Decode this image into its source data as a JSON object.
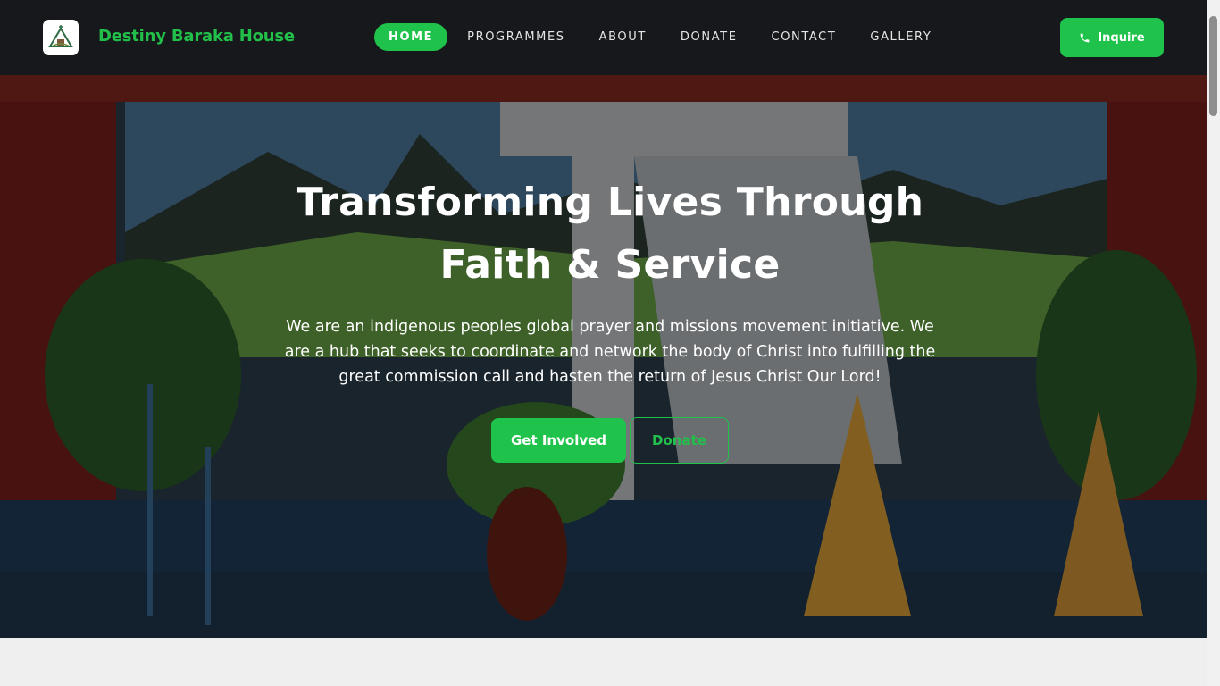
{
  "brand": {
    "name": "Destiny Baraka House",
    "logo_icon": "church-logo-icon"
  },
  "nav": {
    "items": [
      {
        "label": "HOME",
        "active": true
      },
      {
        "label": "PROGRAMMES",
        "active": false
      },
      {
        "label": "ABOUT",
        "active": false
      },
      {
        "label": "DONATE",
        "active": false
      },
      {
        "label": "CONTACT",
        "active": false
      },
      {
        "label": "GALLERY",
        "active": false
      }
    ],
    "inquire_label": "Inquire",
    "inquire_icon": "phone-icon"
  },
  "hero": {
    "title_line1": "Transforming Lives Through",
    "title_line2": "Faith & Service",
    "text": "We are an indigenous peoples global prayer and missions movement initiative. We are a hub that seeks to coordinate and network the body of Christ into fulfilling the great commission call and hasten the return of Jesus Christ Our Lord!",
    "primary_button": "Get Involved",
    "secondary_button": "Donate"
  },
  "colors": {
    "accent": "#1fc24a",
    "nav_bg": "#16181a",
    "page_bg": "#efefef"
  }
}
